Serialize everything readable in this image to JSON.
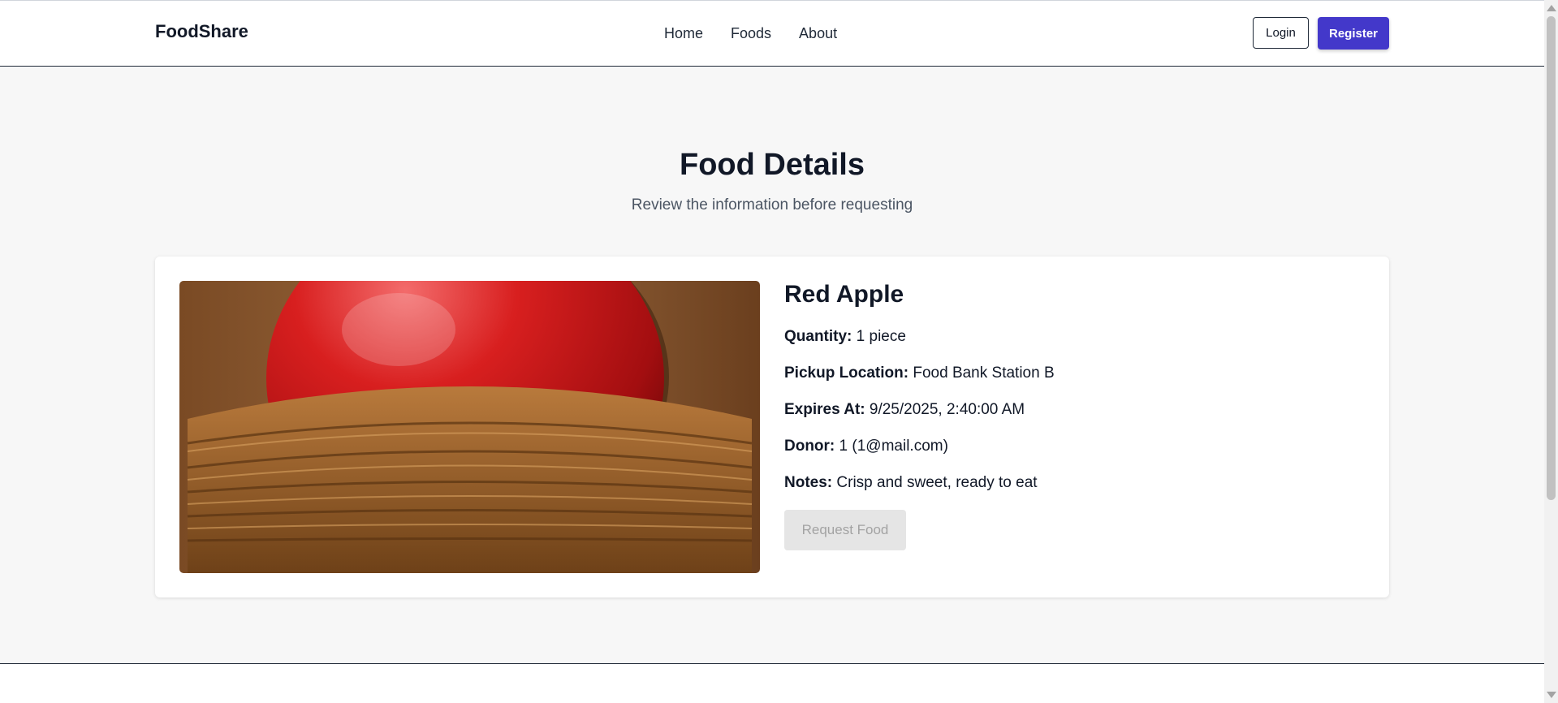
{
  "header": {
    "brand": "FoodShare",
    "nav": [
      {
        "label": "Home"
      },
      {
        "label": "Foods"
      },
      {
        "label": "About"
      }
    ],
    "login_label": "Login",
    "register_label": "Register"
  },
  "page": {
    "title": "Food Details",
    "subtitle": "Review the information before requesting"
  },
  "food": {
    "name": "Red Apple",
    "image_icon": "apple-in-basket-photo",
    "fields": [
      {
        "key": "Quantity:",
        "value": "1 piece"
      },
      {
        "key": "Pickup Location:",
        "value": "Food Bank Station B"
      },
      {
        "key": "Expires At:",
        "value": "9/25/2025, 2:40:00 AM"
      },
      {
        "key": "Donor:",
        "value": "1 (1@mail.com)"
      },
      {
        "key": "Notes:",
        "value": "Crisp and sweet, ready to eat"
      }
    ],
    "request_label": "Request Food",
    "request_enabled": false
  },
  "colors": {
    "accent": "#4338ca",
    "page_background": "#f7f7f7",
    "disabled_button": "#e5e5e5"
  }
}
